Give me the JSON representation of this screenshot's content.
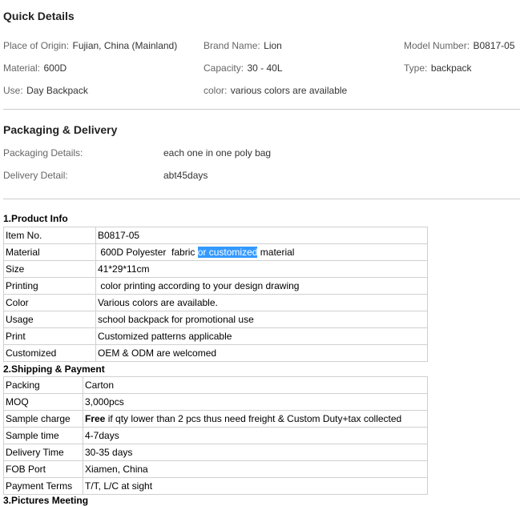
{
  "quick_details": {
    "title": "Quick Details",
    "items": [
      {
        "label": "Place of Origin:",
        "value": "Fujian, China (Mainland)"
      },
      {
        "label": "Brand Name:",
        "value": "Lion"
      },
      {
        "label": "Model Number:",
        "value": "B0817-05"
      },
      {
        "label": "Material:",
        "value": "600D"
      },
      {
        "label": "Capacity:",
        "value": "30 - 40L"
      },
      {
        "label": "Type:",
        "value": "backpack"
      },
      {
        "label": "Use:",
        "value": "Day Backpack"
      },
      {
        "label": "color:",
        "value": "various colors are available"
      }
    ]
  },
  "packaging": {
    "title": "Packaging & Delivery",
    "details_label": "Packaging Details:",
    "details_value": "each one in one poly bag",
    "delivery_label": "Delivery Detail:",
    "delivery_value": "abt45days"
  },
  "product_info": {
    "title": "1.Product Info",
    "rows": [
      {
        "label": "Item No.",
        "value": "B0817-05"
      },
      {
        "label": "Material",
        "value_pre": " 600D Polyester  fabric ",
        "value_highlight": "or customized",
        "value_post": " material"
      },
      {
        "label": "Size",
        "value": "41*29*11cm"
      },
      {
        "label": "Printing",
        "value": " color printing according to your design drawing"
      },
      {
        "label": "Color",
        "value": "Various colors are available."
      },
      {
        "label": "Usage",
        "value": "school backpack for promotional use"
      },
      {
        "label": "Print",
        "value": "Customized patterns applicable"
      },
      {
        "label": "Customized",
        "value": "OEM & ODM are welcomed"
      }
    ]
  },
  "shipping": {
    "title": "2.Shipping & Payment",
    "rows": [
      {
        "label": "Packing",
        "value": "Carton"
      },
      {
        "label": "MOQ",
        "value": "3,000pcs"
      },
      {
        "label": "Sample charge",
        "value_bold": "Free",
        "value": " if qty lower than 2 pcs thus need freight & Custom Duty+tax collected"
      },
      {
        "label": "Sample time",
        "value": "4-7days"
      },
      {
        "label": "Delivery Time",
        "value": "30-35 days"
      },
      {
        "label": "FOB Port",
        "value": "Xiamen, China"
      },
      {
        "label": "Payment Terms",
        "value": "T/T, L/C at sight"
      }
    ]
  },
  "next_section_partial": "3.Pictures Meeting"
}
